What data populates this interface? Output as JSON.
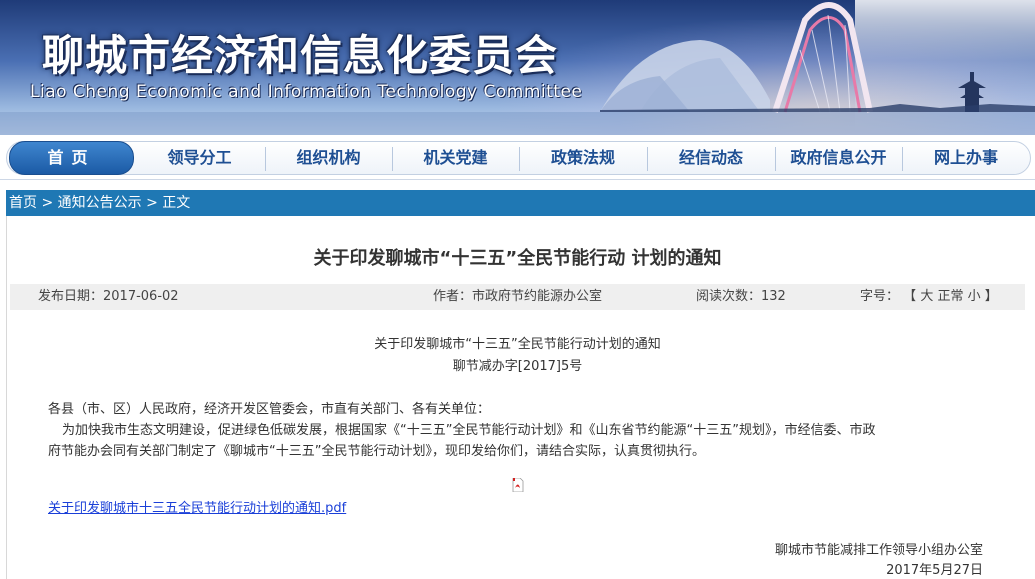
{
  "banner": {
    "title": "聊城市经济和信息化委员会",
    "subtitle": "Liao Cheng Economic and Information Technology Committee"
  },
  "nav": {
    "items": [
      {
        "label": "首页"
      },
      {
        "label": "领导分工"
      },
      {
        "label": "组织机构"
      },
      {
        "label": "机关党建"
      },
      {
        "label": "政策法规"
      },
      {
        "label": "经信动态"
      },
      {
        "label": "政府信息公开"
      },
      {
        "label": "网上办事"
      }
    ]
  },
  "breadcrumb": {
    "home": "首页",
    "sep1": " > ",
    "section": "通知公告公示",
    "sep2": " > ",
    "current": "正文"
  },
  "article": {
    "title": "关于印发聊城市“十三五”全民节能行动 计划的通知",
    "meta": {
      "date_label": "发布日期：",
      "date": "2017-06-02",
      "author_label": "作者：",
      "author": "市政府节约能源办公室",
      "views_label": "阅读次数：",
      "views": "132",
      "font_label": "字号：",
      "font_open": "【",
      "font_large": "大",
      "font_normal": "正常",
      "font_small": "小",
      "font_close": "】"
    },
    "doc_title": "关于印发聊城市“十三五”全民节能行动计划的通知",
    "doc_number": "聊节减办字[2017]5号",
    "salutation": "各县（市、区）人民政府，经济开发区管委会，市直有关部门、各有关单位：",
    "body_line1": "为加快我市生态文明建设，促进绿色低碳发展，根据国家《“十三五”全民节能行动计划》和《山东省节约能源“十三五”规划》，市经信委、市政",
    "body_line2": "府节能办会同有关部门制定了《聊城市“十三五”全民节能行动计划》，现印发给你们，请结合实际，认真贯彻执行。",
    "attachment": "关于印发聊城市十三五全民节能行动计划的通知.pdf",
    "signature": "聊城市节能减排工作领导小组办公室",
    "sign_date": "2017年5月27日"
  },
  "colors": {
    "accent": "#1f78b4",
    "nav_text": "#1e4f93",
    "link": "#1a3fd8"
  }
}
